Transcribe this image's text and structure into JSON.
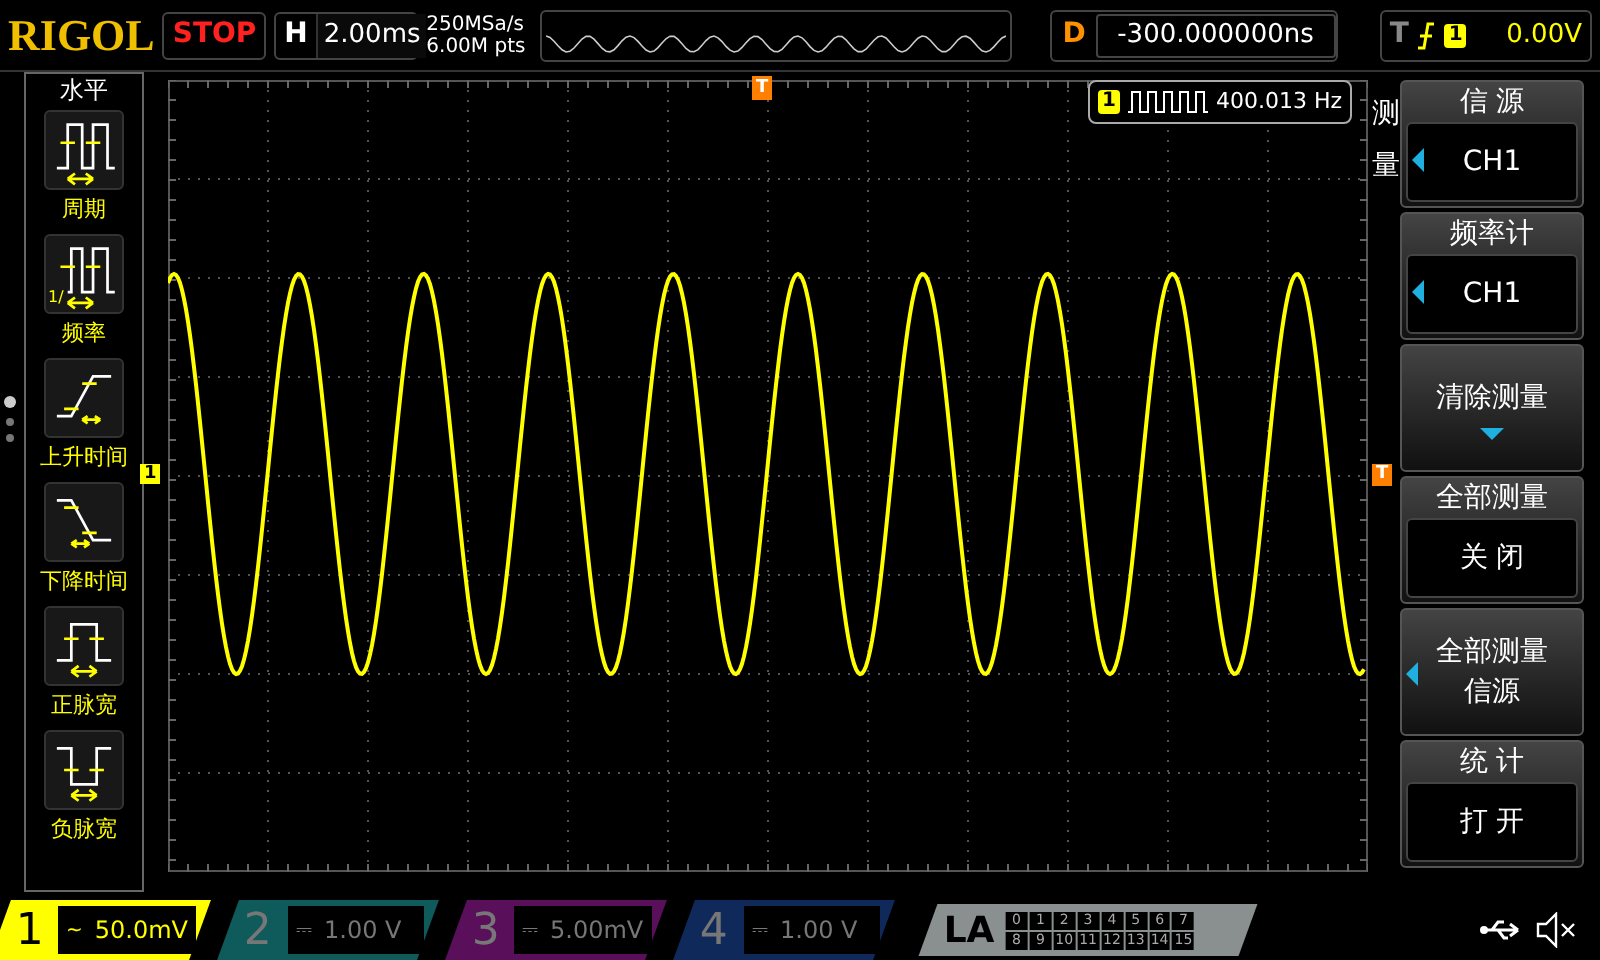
{
  "top_bar": {
    "logo": "RIGOL",
    "run_state": "STOP",
    "horizontal": {
      "label": "H",
      "value": "2.00ms"
    },
    "sample_rate": "250MSa/s",
    "memory_depth": "6.00M pts",
    "delay": {
      "label": "D",
      "value": "-300.000000ns"
    },
    "trigger": {
      "label": "T",
      "source": "1",
      "level": "0.00V"
    }
  },
  "left_menu": {
    "title": "水平",
    "items": [
      {
        "kind": "period",
        "label": "周期"
      },
      {
        "kind": "frequency",
        "label": "频率",
        "icon_text": "1/"
      },
      {
        "kind": "rise",
        "label": "上升时间"
      },
      {
        "kind": "fall",
        "label": "下降时间"
      },
      {
        "kind": "pos_width",
        "label": "正脉宽"
      },
      {
        "kind": "neg_width",
        "label": "负脉宽"
      }
    ]
  },
  "display": {
    "measurement": {
      "channel": "1",
      "value": "400.013 Hz"
    },
    "channel_marker": "1",
    "trigger_marker_top": "T",
    "trigger_marker_right": "T"
  },
  "right_menu": {
    "title": "测量",
    "items": [
      {
        "kind": "select",
        "title": "信 源",
        "value": "CH1"
      },
      {
        "kind": "select",
        "title": "频率计",
        "value": "CH1"
      },
      {
        "kind": "action",
        "label": "清除测量"
      },
      {
        "kind": "toggle",
        "title": "全部测量",
        "value": "关 闭"
      },
      {
        "kind": "select_big",
        "lines": [
          "全部测量",
          "信源"
        ]
      },
      {
        "kind": "toggle",
        "title": "统 计",
        "value": "打 开"
      }
    ]
  },
  "channels": [
    {
      "number": "1",
      "coupling": "~",
      "scale": "50.0mV",
      "selected": true,
      "color": "#ffff00"
    },
    {
      "number": "2",
      "coupling": "⎓",
      "scale": "1.00 V",
      "selected": false,
      "color": "#0f5a5a"
    },
    {
      "number": "3",
      "coupling": "⎓",
      "scale": "5.00mV",
      "selected": false,
      "color": "#5a0f5a"
    },
    {
      "number": "4",
      "coupling": "⎓",
      "scale": "1.00 V",
      "selected": false,
      "color": "#0f2a5a"
    }
  ],
  "logic_analyzer": {
    "label": "LA",
    "digits": [
      "0",
      "1",
      "2",
      "3",
      "4",
      "5",
      "6",
      "7",
      "8",
      "9",
      "10",
      "11",
      "12",
      "13",
      "14",
      "15"
    ]
  }
}
